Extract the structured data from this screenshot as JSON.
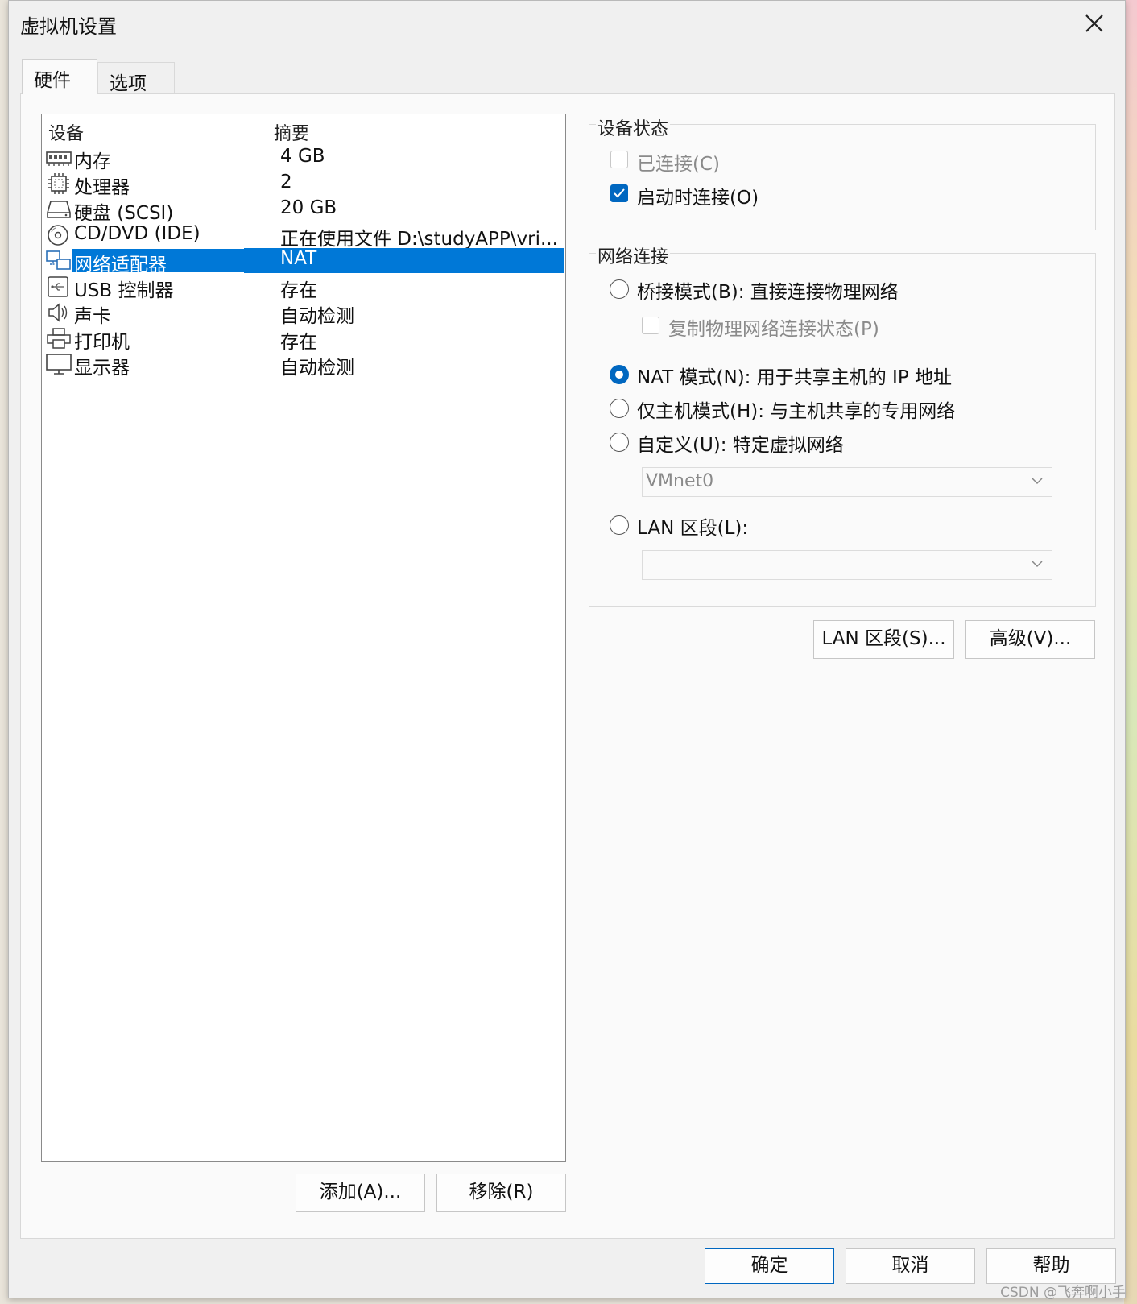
{
  "window": {
    "title": "虚拟机设置"
  },
  "tabs": [
    {
      "label": "硬件",
      "active": true
    },
    {
      "label": "选项",
      "active": false
    }
  ],
  "device_list": {
    "columns": [
      "设备",
      "摘要"
    ],
    "rows": [
      {
        "name": "内存",
        "summary": "4 GB",
        "icon": "memory-icon"
      },
      {
        "name": "处理器",
        "summary": "2",
        "icon": "processor-icon"
      },
      {
        "name": "硬盘 (SCSI)",
        "summary": "20 GB",
        "icon": "hard-disk-icon"
      },
      {
        "name": "CD/DVD (IDE)",
        "summary": "正在使用文件 D:\\studyAPP\\vri...",
        "icon": "cd-dvd-icon"
      },
      {
        "name": "网络适配器",
        "summary": "NAT",
        "icon": "network-adapter-icon",
        "selected": true
      },
      {
        "name": "USB 控制器",
        "summary": "存在",
        "icon": "usb-icon"
      },
      {
        "name": "声卡",
        "summary": "自动检测",
        "icon": "speaker-icon"
      },
      {
        "name": "打印机",
        "summary": "存在",
        "icon": "printer-icon"
      },
      {
        "name": "显示器",
        "summary": "自动检测",
        "icon": "monitor-icon"
      }
    ]
  },
  "left_buttons": {
    "add": "添加(A)...",
    "remove": "移除(R)"
  },
  "device_status": {
    "title": "设备状态",
    "connected": {
      "label": "已连接(C)",
      "checked": false,
      "enabled": false
    },
    "connect_at_power_on": {
      "label": "启动时连接(O)",
      "checked": true,
      "enabled": true
    }
  },
  "network": {
    "title": "网络连接",
    "bridged": {
      "label": "桥接模式(B): 直接连接物理网络",
      "checked": false
    },
    "replicate": {
      "label": "复制物理网络连接状态(P)",
      "checked": false,
      "enabled": false
    },
    "nat": {
      "label": "NAT 模式(N): 用于共享主机的 IP 地址",
      "checked": true
    },
    "host_only": {
      "label": "仅主机模式(H): 与主机共享的专用网络",
      "checked": false
    },
    "custom": {
      "label": "自定义(U): 特定虚拟网络",
      "checked": false
    },
    "custom_select": "VMnet0",
    "lan": {
      "label": "LAN 区段(L):",
      "checked": false
    },
    "lan_select": ""
  },
  "right_buttons": {
    "lan_segments": "LAN 区段(S)...",
    "advanced": "高级(V)..."
  },
  "footer_buttons": {
    "ok": "确定",
    "cancel": "取消",
    "help": "帮助"
  },
  "watermark": "CSDN @飞奔啊小手",
  "colors": {
    "selection": "#0078d7",
    "accent": "#0067c0"
  }
}
